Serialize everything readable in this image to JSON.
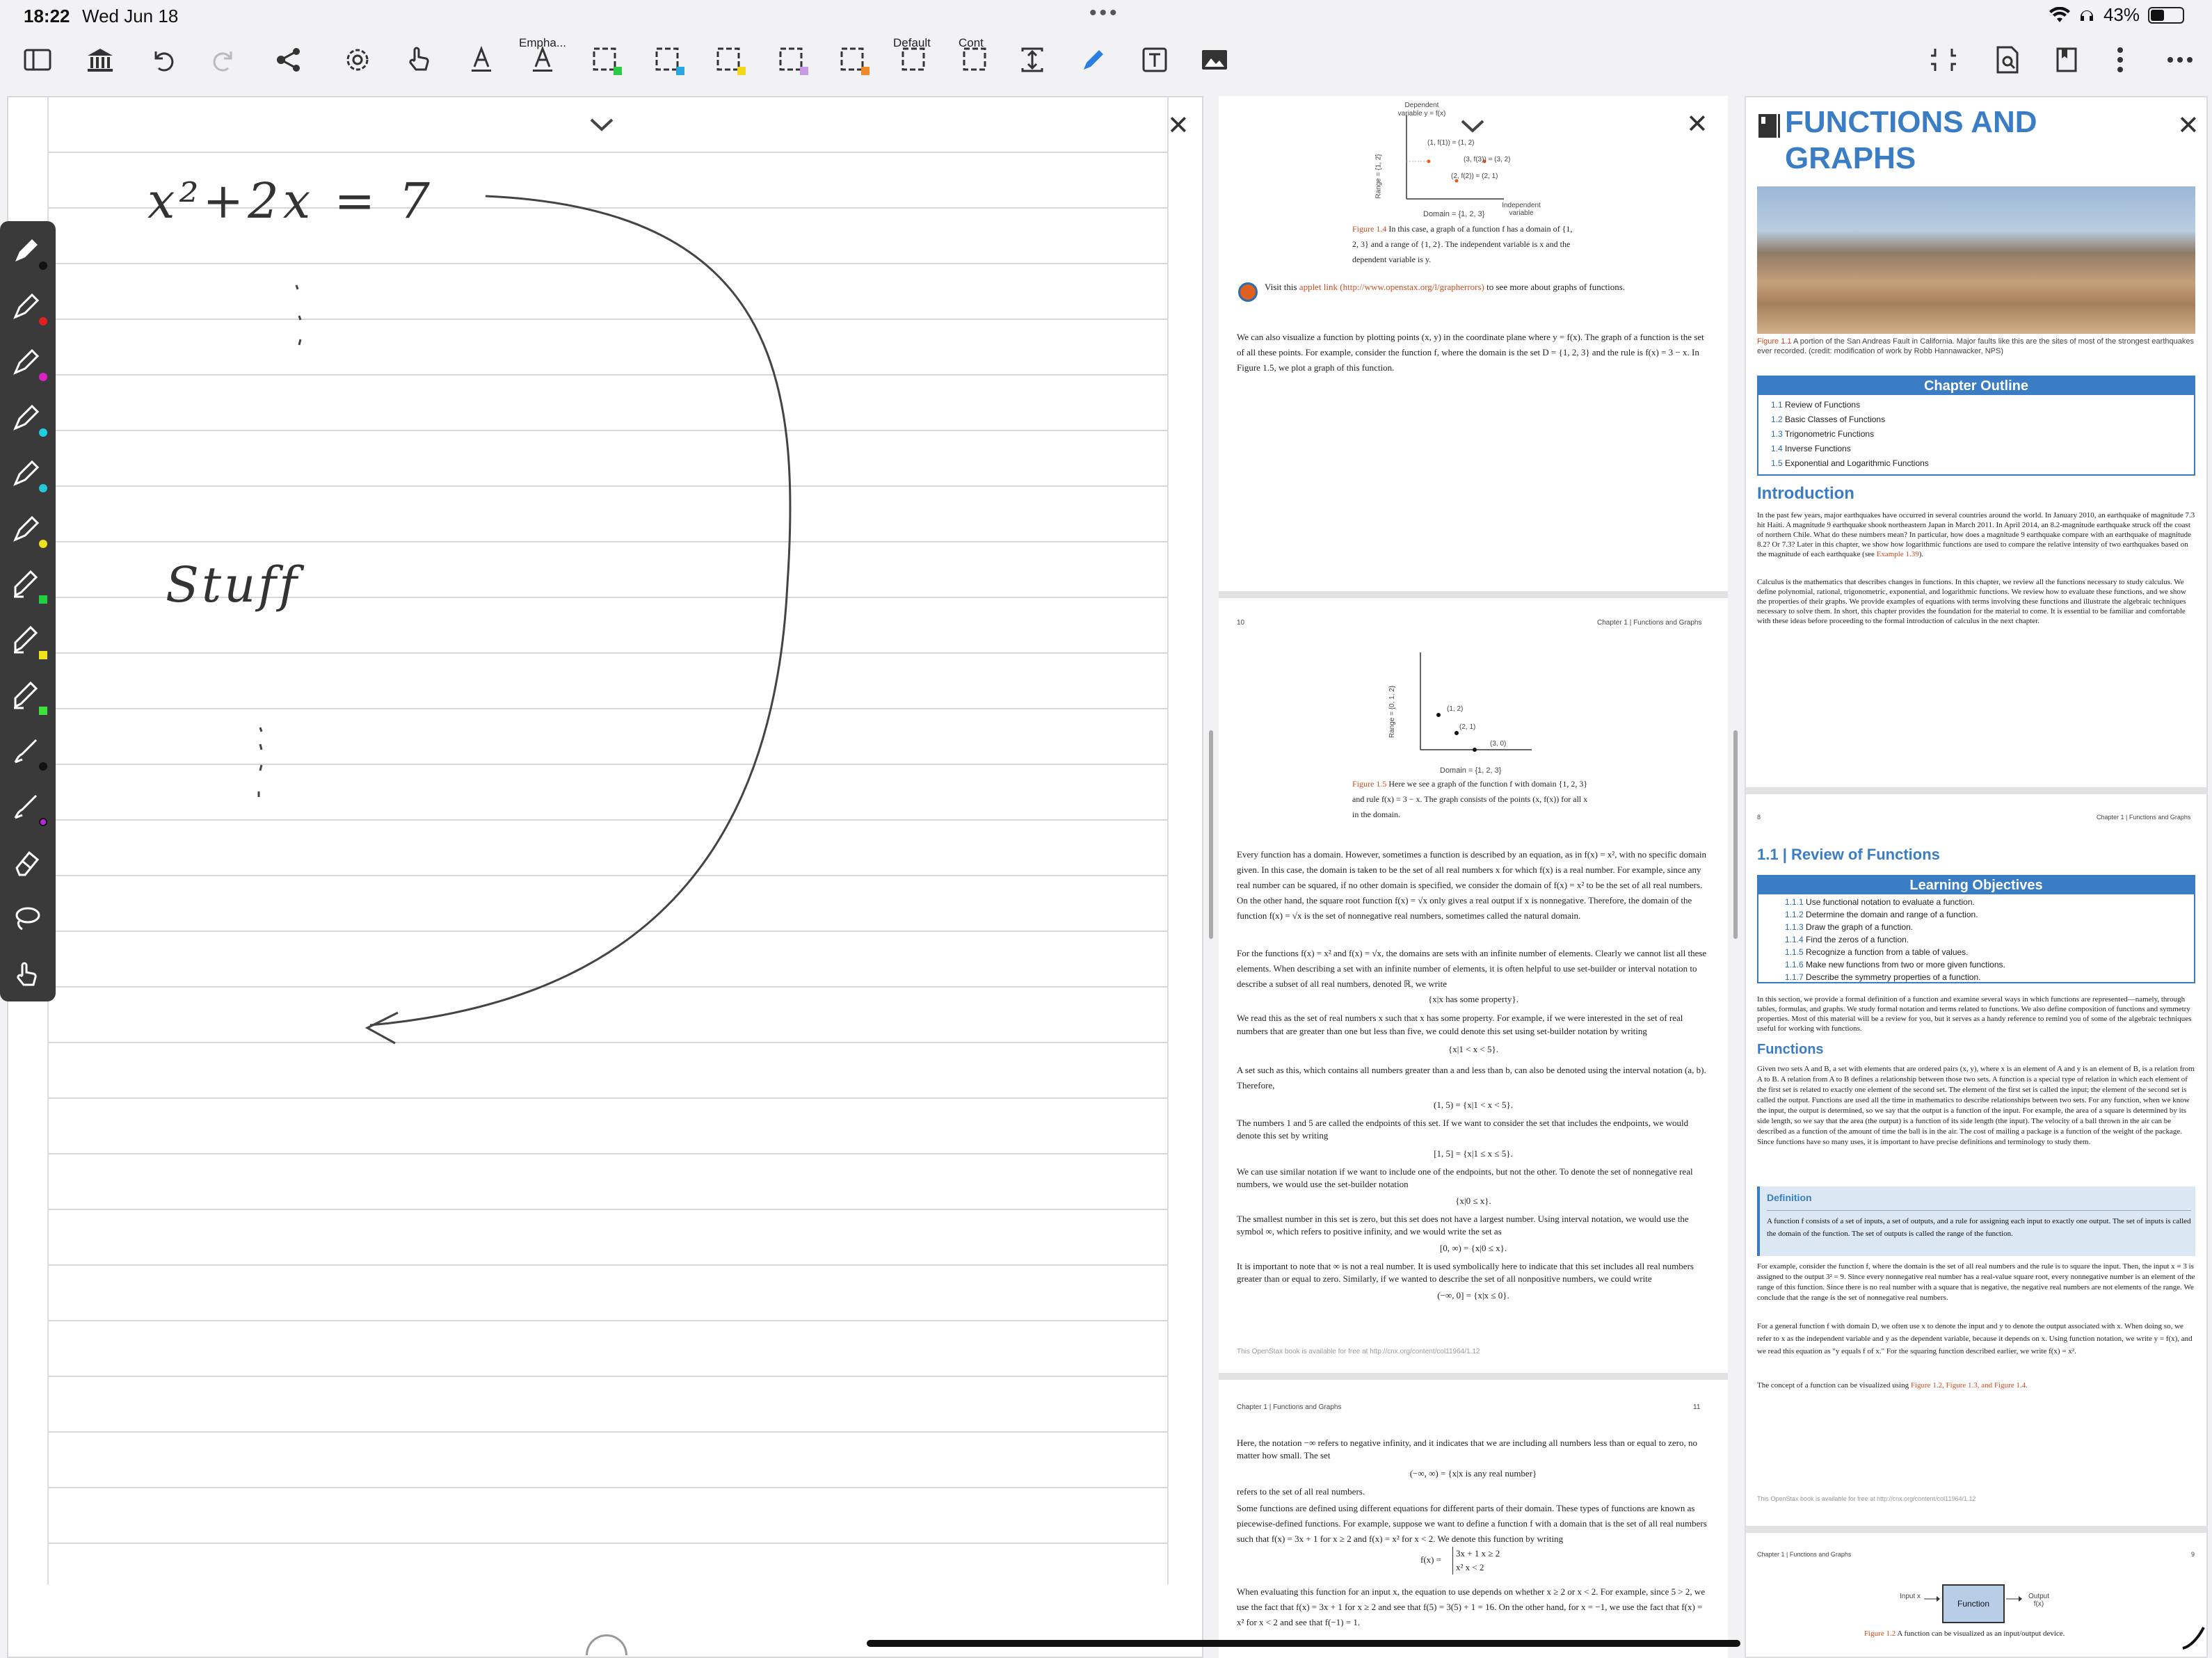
{
  "status": {
    "time": "18:22",
    "date": "Wed Jun 18",
    "dots": "•••",
    "battery": "43%"
  },
  "toolbar": {
    "label_empha": "Empha...",
    "label_default": "Default",
    "label_cont": "Cont"
  },
  "notes": {
    "line1": "x²+2x = 7",
    "line2": "Stuff"
  },
  "pdf": {
    "fig14_caption": "Figure 1.4",
    "fig14_text": "In this case, a graph of a function  f  has a domain of {1, 2, 3} and a range of {1, 2}. The independent variable is  x  and the dependent variable is  y.",
    "fig14_dep": "Dependent variable y = f(x)",
    "fig14_range": "Range = {1, 2}",
    "fig14_domain": "Domain = {1, 2, 3}",
    "fig14_indep": "Independent variable",
    "fig14_p1": "(1, f(1)) = (1, 2)",
    "fig14_p2": "(3, f(3)) = (3, 2)",
    "fig14_p3": "(2, f(2)) = (2, 1)",
    "applet_pre": "Visit this ",
    "applet_link": "applet link (http://www.openstax.org/l/grapherrors)",
    "applet_post": " to see more about graphs of functions.",
    "para_graph": "We can also visualize a function by plotting points (x, y) in the coordinate plane where y = f(x). The graph of a function is the set of all these points. For example, consider the function f, where the domain is the set D = {1, 2, 3} and the rule is f(x) = 3 − x. In Figure 1.5, we plot a graph of this function.",
    "page10_num": "10",
    "page10_chapter": "Chapter 1 | Functions and Graphs",
    "fig15_caption": "Figure 1.5",
    "fig15_text": "Here we see a graph of the function  f  with domain {1, 2, 3} and rule  f(x) = 3 − x. The graph consists of the points (x, f(x)) for all x in the domain.",
    "fig15_p1": "(1, 2)",
    "fig15_p2": "(2, 1)",
    "fig15_p3": "(3, 0)",
    "fig15_range": "Range = {0, 1, 2}",
    "fig15_domain": "Domain = {1, 2, 3}",
    "para_domain1": "Every function has a domain. However, sometimes a function is described by an equation, as in f(x) = x², with no specific domain given. In this case, the domain is taken to be the set of all real numbers x for which f(x) is a real number. For example, since any real number can be squared, if no other domain is specified, we consider the domain of f(x) = x² to be the set of all real numbers. On the other hand, the square root function f(x) = √x only gives a real output if x is nonnegative. Therefore, the domain of the function f(x) = √x is the set of nonnegative real numbers, sometimes called the natural domain.",
    "para_domain2": "For the functions f(x) = x² and f(x) = √x, the domains are sets with an infinite number of elements. Clearly we cannot list all these elements. When describing a set with an infinite number of elements, it is often helpful to use set-builder or interval notation to describe a subset of all real numbers, denoted ℝ, we write",
    "eq1": "{x|x has some property}.",
    "para_setb": "We read this as the set of real numbers x such that x has some property. For example, if we were interested in the set of real numbers that are greater than one but less than five, we could denote this set using set-builder notation by writing",
    "eq2": "{x|1 < x < 5}.",
    "para_interval": "A set such as this, which contains all numbers greater than a and less than b, can also be denoted using the interval notation (a, b). Therefore,",
    "eq3": "(1, 5) = {x|1 < x < 5}.",
    "para_endpoints": "The numbers 1 and 5 are called the endpoints of this set. If we want to consider the set that includes the endpoints, we would denote this set by writing",
    "eq4": "[1, 5] = {x|1 ≤ x ≤ 5}.",
    "para_nonneg": "We can use similar notation if we want to include one of the endpoints, but not the other. To denote the set of nonnegative real numbers, we would use the set-builder notation",
    "eq5": "{x|0 ≤ x}.",
    "para_smallest": "The smallest number in this set is zero, but this set does not have a largest number. Using interval notation, we would use the symbol ∞, which refers to positive infinity, and we would write the set as",
    "eq6": "[0, ∞) = {x|0 ≤ x}.",
    "para_inf": "It is important to note that ∞ is not a real number. It is used symbolically here to indicate that this set includes all real numbers greater than or equal to zero. Similarly, if we wanted to describe the set of all nonpositive numbers, we could write",
    "eq7": "(−∞, 0] = {x|x ≤ 0}.",
    "footer10": "This OpenStax book is available for free at http://cnx.org/content/col11964/1.12",
    "page11_chapter": "Chapter 1 | Functions and Graphs",
    "page11_num": "11",
    "para_neginf": "Here, the notation −∞ refers to negative infinity, and it indicates that we are including all numbers less than or equal to zero, no matter how small. The set",
    "eq8": "(−∞, ∞) = {x|x is any real number}",
    "para_allreal": "refers to the set of all real numbers.",
    "para_piece": "Some functions are defined using different equations for different parts of their domain. These types of functions are known as piecewise-defined functions. For example, suppose we want to define a function f with a domain that is the set of all real numbers such that f(x) = 3x + 1 for x ≥ 2 and f(x) = x² for x < 2. We denote this function by writing",
    "eq9a": "f(x) = ",
    "eq9b": "3x + 1     x ≥ 2",
    "eq9c": "x²           x < 2",
    "para_eval": "When evaluating this function for an input x, the equation to use depends on whether x ≥ 2 or x < 2. For example, since 5 > 2, we use the fact that f(x) = 3x + 1 for x ≥ 2 and see that f(5) = 3(5) + 1 = 16. On the other hand, for x = −1, we use the fact that f(x) = x² for x < 2 and see that f(−1) = 1."
  },
  "right": {
    "title": "FUNCTIONS AND GRAPHS",
    "fig11_caption": "Figure 1.1",
    "fig11_text": "A portion of the San Andreas Fault in California. Major faults like this are the sites of most of the strongest earthquakes ever recorded. (credit: modification of work by Robb Hannawacker, NPS)",
    "outline_head": "Chapter Outline",
    "outline": [
      {
        "n": "1.1",
        "t": " Review of Functions"
      },
      {
        "n": "1.2",
        "t": " Basic Classes of Functions"
      },
      {
        "n": "1.3",
        "t": " Trigonometric Functions"
      },
      {
        "n": "1.4",
        "t": " Inverse Functions"
      },
      {
        "n": "1.5",
        "t": " Exponential and Logarithmic Functions"
      }
    ],
    "intro_head": "Introduction",
    "intro1_a": "In the past few years, major earthquakes have occurred in several countries around the world. In January 2010, an earthquake of magnitude 7.3 hit Haiti. A magnitude 9 earthquake shook northeastern Japan in March 2011. In April 2014, an 8.2-magnitude earthquake struck off the coast of northern Chile. What do these numbers mean? In particular, how does a magnitude 9 earthquake compare with an earthquake of magnitude 8.2? Or 7.3? Later in this chapter, we show how logarithmic functions are used to compare the relative intensity of two earthquakes based on the magnitude of each earthquake (see ",
    "intro1_link": "Example 1.39",
    "intro1_b": ").",
    "intro2": "Calculus is the mathematics that describes changes in functions. In this chapter, we review all the functions necessary to study calculus. We define polynomial, rational, trigonometric, exponential, and logarithmic functions. We review how to evaluate these functions, and we show the properties of their graphs. We provide examples of equations with terms involving these functions and illustrate the algebraic techniques necessary to solve them. In short, this chapter provides the foundation for the material to come. It is essential to be familiar and comfortable with these ideas before proceeding to the formal introduction of calculus in the next chapter.",
    "page8_num": "8",
    "page8_chapter": "Chapter 1 | Functions and Graphs",
    "sec_num": "1.1",
    "sec_title": "Review of Functions",
    "lo_head": "Learning Objectives",
    "lo": [
      {
        "n": "1.1.1",
        "t": " Use functional notation to evaluate a function."
      },
      {
        "n": "1.1.2",
        "t": " Determine the domain and range of a function."
      },
      {
        "n": "1.1.3",
        "t": " Draw the graph of a function."
      },
      {
        "n": "1.1.4",
        "t": " Find the zeros of a function."
      },
      {
        "n": "1.1.5",
        "t": " Recognize a function from a table of values."
      },
      {
        "n": "1.1.6",
        "t": " Make new functions from two or more given functions."
      },
      {
        "n": "1.1.7",
        "t": " Describe the symmetry properties of a function."
      }
    ],
    "sec_intro": "In this section, we provide a formal definition of a function and examine several ways in which functions are represented—namely, through tables, formulas, and graphs. We study formal notation and terms related to functions. We also define composition of functions and symmetry properties. Most of this material will be a review for you, but it serves as a handy reference to remind you of some of the algebraic techniques useful for working with functions.",
    "func_head": "Functions",
    "func_para": "Given two sets A and B, a set with elements that are ordered pairs (x, y), where x is an element of A and y is an element of B, is a relation from A to B. A relation from A to B defines a relationship between those two sets. A function is a special type of relation in which each element of the first set is related to exactly one element of the second set. The element of the first set is called the input; the element of the second set is called the output. Functions are used all the time in mathematics to describe relationships between two sets. For any function, when we know the input, the output is determined, so we say that the output is a function of the input. For example, the area of a square is determined by its side length, so we say that the area (the output) is a function of its side length (the input). The velocity of a ball thrown in the air can be described as a function of the amount of time the ball is in the air. The cost of mailing a package is a function of the weight of the package. Since functions have so many uses, it is important to have precise definitions and terminology to study them.",
    "def_head": "Definition",
    "def_text": "A function f consists of a set of inputs, a set of outputs, and a rule for assigning each input to exactly one output. The set of inputs is called the domain of the function. The set of outputs is called the range of the function.",
    "ex_para": "For example, consider the function f, where the domain is the set of all real numbers and the rule is to square the input. Then, the input x = 3 is assigned to the output 3² = 9. Since every nonnegative real number has a real-value square root, every nonnegative number is an element of the range of this function. Since there is no real number with a square that is negative, the negative real numbers are not elements of the range. We conclude that the range is the set of nonnegative real numbers.",
    "gen_para": "For a general function f with domain D, we often use x to denote the input and y to denote the output associated with x. When doing so, we refer to x as the independent variable and y as the dependent variable, because it depends on x. Using function notation, we write y = f(x), and we read this equation as \"y equals f of x.\" For the squaring function described earlier, we write f(x) = x².",
    "concept_a": "The concept of a function can be visualized using ",
    "concept_links": "Figure 1.2, Figure 1.3, and Figure 1.4.",
    "footer8": "This OpenStax book is available for free at http://cnx.org/content/col11964/1.12",
    "page9_chapter": "Chapter 1 | Functions and Graphs",
    "page9_num": "9",
    "fig12_input": "Input x",
    "fig12_box": "Function",
    "fig12_output": "Output f(x)",
    "fig12_caption": "Figure 1.2",
    "fig12_text": "A function can be visualized as an input/output device."
  }
}
